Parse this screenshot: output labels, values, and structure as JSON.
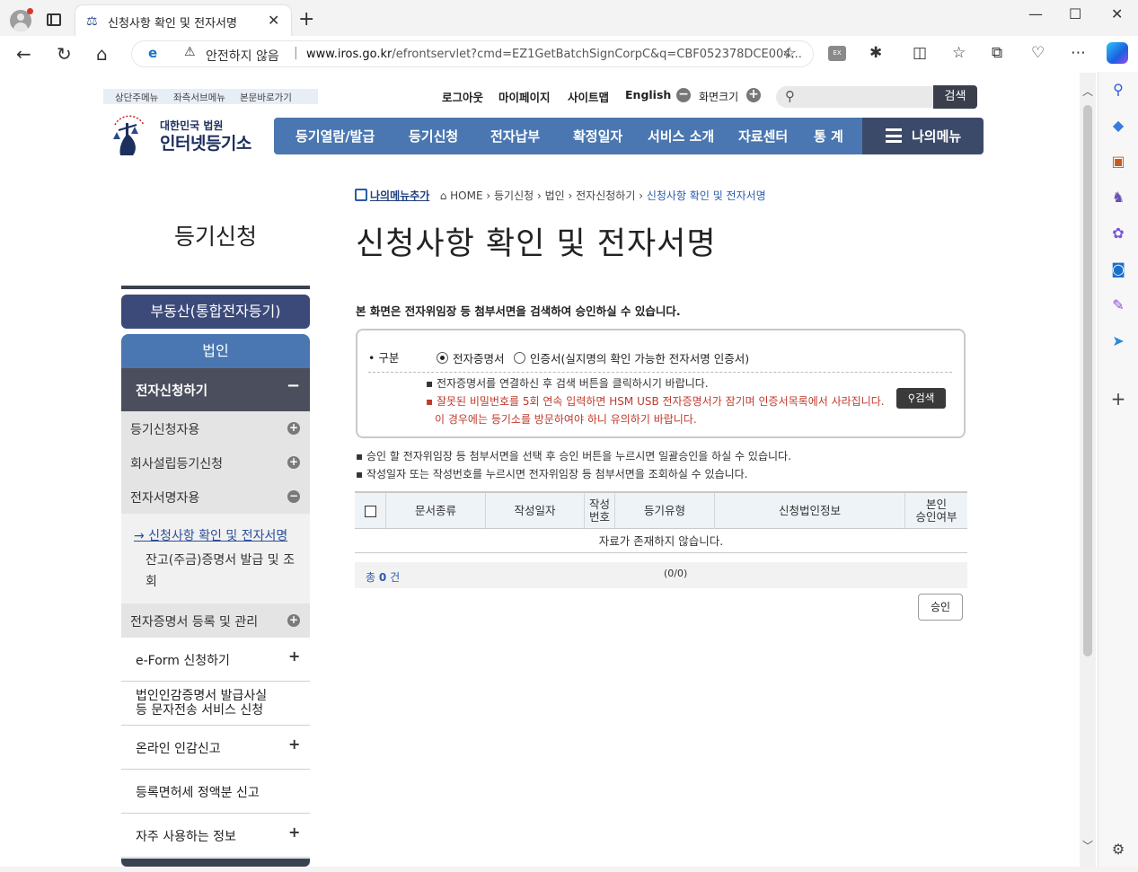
{
  "browser": {
    "tab_title": "신청사항 확인 및 전자서명",
    "not_secure": "안전하지 않음",
    "url_host": "www.iros.go.kr",
    "url_path": "/efrontservlet?cmd=EZ1GetBatchSignCorpC&q=CBF052378DCE004..."
  },
  "header": {
    "skip_links": [
      "상단주메뉴",
      "좌측서브메뉴",
      "본문바로가기"
    ],
    "util_links": [
      "로그아웃",
      "마이페이지",
      "사이트맵",
      "English"
    ],
    "zoom_label": "화면크기",
    "search_button": "검색",
    "logo_sub": "대한민국 법원",
    "logo_main": "인터넷등기소",
    "gnb": [
      "등기열람/발급",
      "등기신청",
      "전자납부",
      "확정일자",
      "서비스 소개",
      "자료센터",
      "통 계"
    ],
    "my_menu": "나의메뉴"
  },
  "lnb": {
    "title": "등기신청",
    "pill1": "부동산(통합전자등기)",
    "pill2": "법인",
    "depth1": "전자신청하기",
    "depth1_toggle": "−",
    "subs": [
      "등기신청자용",
      "회사설립등기신청",
      "전자서명자용"
    ],
    "sub3_items": [
      "→ 신청사항 확인 및 전자서명",
      "잔고(주금)증명서 발급 및 조회"
    ],
    "sub4": "전자증명서 등록 및 관리",
    "items": [
      "e-Form 신청하기",
      "법인인감증명서 발급사실 등 문자전송 서비스 신청",
      "온라인 인감신고",
      "등록면허세 정액분 신고",
      "자주 사용하는 정보"
    ],
    "item_line_1": "법인인감증명서 발급사실",
    "item_line_2": "등 문자전송 서비스 신청"
  },
  "content": {
    "add_my_menu": "나의메뉴추가",
    "breadcrumb": [
      "HOME",
      "등기신청",
      "법인",
      "전자신청하기"
    ],
    "breadcrumb_current": "신청사항 확인 및 전자서명",
    "title": "신청사항 확인 및 전자서명",
    "intro": "본 화면은 전자위임장 등 첨부서면을 검색하여 승인하실 수 있습니다.",
    "form": {
      "label": "구분",
      "radio1": "전자증명서",
      "radio2": "인증서(실지명의 확인 가능한 전자서명 인증서)",
      "note1": "전자증명서를 연결하신 후 검색 버튼을 클릭하시기 바랍니다.",
      "note2": "잘못된 비밀번호를 5회 연속 입력하면 HSM USB 전자증명서가 잠기며 인증서목록에서 사라집니다.",
      "note3": "이 경우에는 등기소를 방문하여야 하니 유의하기 바랍니다.",
      "search": "검색"
    },
    "bullets": [
      "승인 할 전자위임장 등 첨부서면을 선택 후 승인 버튼을 누르시면 일괄승인을 하실 수 있습니다.",
      "작성일자 또는 작성번호를 누르시면 전자위임장 등 첨부서면을 조회하실 수 있습니다."
    ],
    "table": {
      "headers": [
        "문서종류",
        "작성일자",
        "작성번호",
        "등기유형",
        "신청법인정보",
        "본인승인여부"
      ],
      "header_lines": {
        "no1": "작성",
        "no2": "번호",
        "ap1": "본인",
        "ap2": "승인여부"
      },
      "empty": "자료가 존재하지 않습니다."
    },
    "total_prefix": "총",
    "total_count": "0",
    "total_suffix": "건",
    "page_info": "(0/0)",
    "approve": "승인"
  }
}
